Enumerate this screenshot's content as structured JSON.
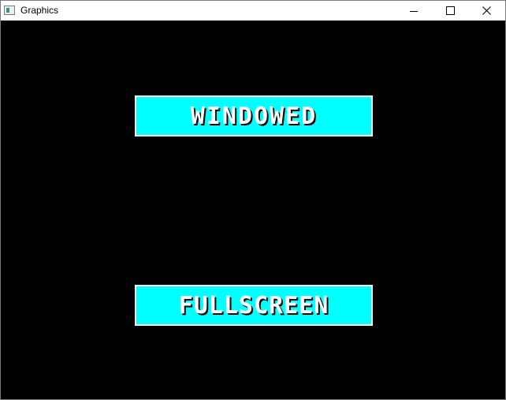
{
  "window": {
    "title": "Graphics",
    "icon": "app-window-icon"
  },
  "titlebar_buttons": {
    "minimize": "minimize-icon",
    "maximize": "maximize-icon",
    "close": "close-icon"
  },
  "menu": {
    "windowed_label": "WINDOWED",
    "fullscreen_label": "FULLSCREEN"
  },
  "colors": {
    "background": "#000000",
    "button_fill": "#00ffff",
    "button_border": "#ffffff",
    "button_text": "#ffffff"
  }
}
